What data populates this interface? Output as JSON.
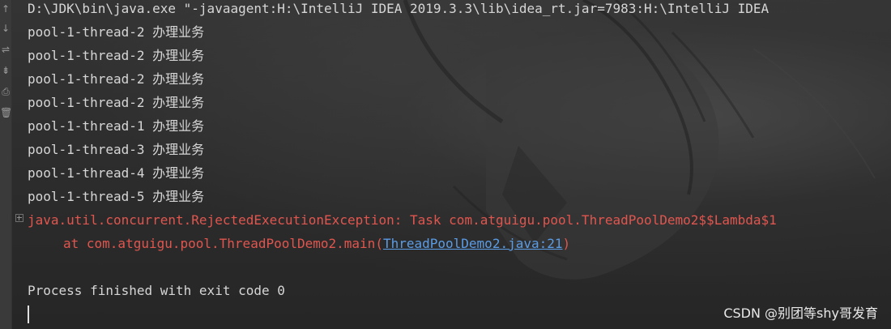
{
  "console": {
    "command_line": "D:\\JDK\\bin\\java.exe \"-javaagent:H:\\IntelliJ IDEA 2019.3.3\\lib\\idea_rt.jar=7983:H:\\IntelliJ IDEA",
    "output_lines": [
      "pool-1-thread-2 办理业务",
      "pool-1-thread-2 办理业务",
      "pool-1-thread-2 办理业务",
      "pool-1-thread-2 办理业务",
      "pool-1-thread-1 办理业务",
      "pool-1-thread-3 办理业务",
      "pool-1-thread-4 办理业务",
      "pool-1-thread-5 办理业务"
    ],
    "exception_line": "java.util.concurrent.RejectedExecutionException: Task com.atguigu.pool.ThreadPoolDemo2$$Lambda$1",
    "stack_prefix": "at com.atguigu.pool.ThreadPoolDemo2.main(",
    "stack_link": "ThreadPoolDemo2.java:21",
    "stack_suffix": ")",
    "exit_message": "Process finished with exit code 0"
  },
  "gutter": {
    "icons": [
      "arrow-up-icon",
      "arrow-down-icon",
      "soft-wrap-icon",
      "scroll-to-end-icon",
      "print-icon",
      "trash-icon"
    ]
  },
  "watermark": "CSDN @别团等shy哥发育"
}
